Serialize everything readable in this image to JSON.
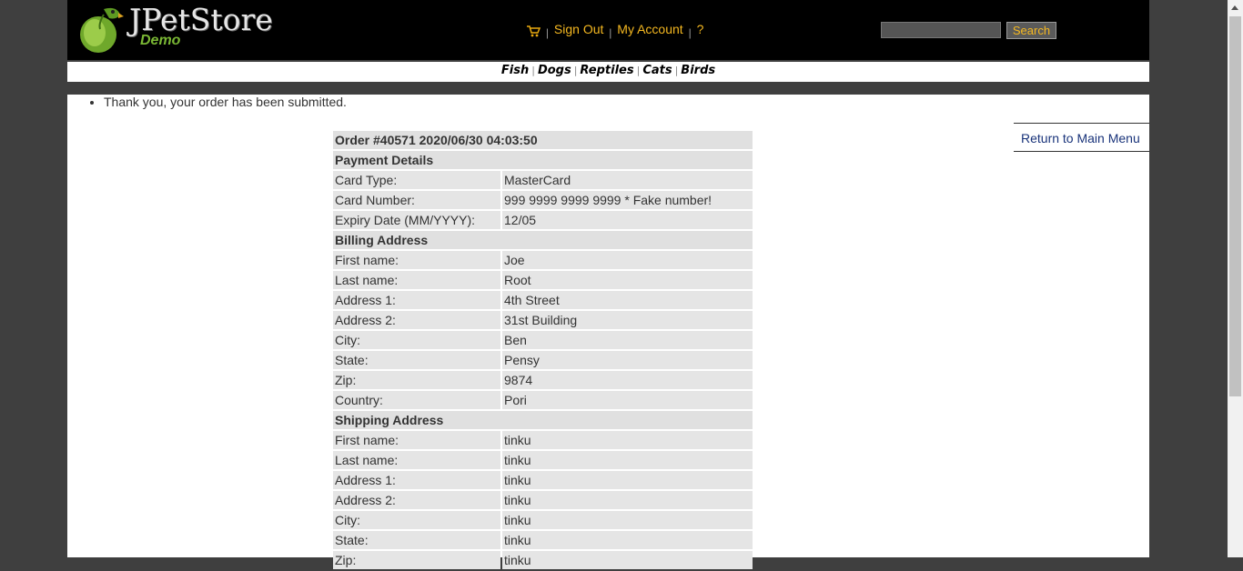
{
  "header": {
    "logo_title": "JPetStore",
    "logo_sub": "Demo",
    "menu": {
      "sign_out": "Sign Out",
      "my_account": "My Account",
      "help": "?",
      "sep": "|"
    },
    "search": {
      "value": "",
      "button": "Search"
    }
  },
  "quicklinks": [
    "Fish",
    "Dogs",
    "Reptiles",
    "Cats",
    "Birds"
  ],
  "messages": [
    "Thank you, your order has been submitted."
  ],
  "return_link": "Return to Main Menu",
  "order": {
    "title": "Order #40571 2020/06/30 04:03:50",
    "payment": {
      "header": "Payment Details",
      "rows": [
        {
          "label": "Card Type:",
          "value": "MasterCard"
        },
        {
          "label": "Card Number:",
          "value": "999 9999 9999 9999 * Fake number!"
        },
        {
          "label": "Expiry Date (MM/YYYY):",
          "value": "12/05"
        }
      ]
    },
    "billing": {
      "header": "Billing Address",
      "rows": [
        {
          "label": "First name:",
          "value": "Joe"
        },
        {
          "label": "Last name:",
          "value": "Root"
        },
        {
          "label": "Address 1:",
          "value": "4th Street"
        },
        {
          "label": "Address 2:",
          "value": "31st Building"
        },
        {
          "label": "City:",
          "value": "Ben"
        },
        {
          "label": "State:",
          "value": "Pensy"
        },
        {
          "label": "Zip:",
          "value": "9874"
        },
        {
          "label": "Country:",
          "value": "Pori"
        }
      ]
    },
    "shipping": {
      "header": "Shipping Address",
      "rows": [
        {
          "label": "First name:",
          "value": "tinku"
        },
        {
          "label": "Last name:",
          "value": "tinku"
        },
        {
          "label": "Address 1:",
          "value": "tinku"
        },
        {
          "label": "Address 2:",
          "value": "tinku"
        },
        {
          "label": "City:",
          "value": "tinku"
        },
        {
          "label": "State:",
          "value": "tinku"
        },
        {
          "label": "Zip:",
          "value": "tinku"
        }
      ]
    }
  },
  "colors": {
    "header_bg": "#000000",
    "menu_link": "#f5b820",
    "row_bg": "#e5e5e5",
    "return_link": "#19337a",
    "logo_green": "#7ab734"
  },
  "icons": [
    "parrot-logo",
    "cart-icon"
  ]
}
